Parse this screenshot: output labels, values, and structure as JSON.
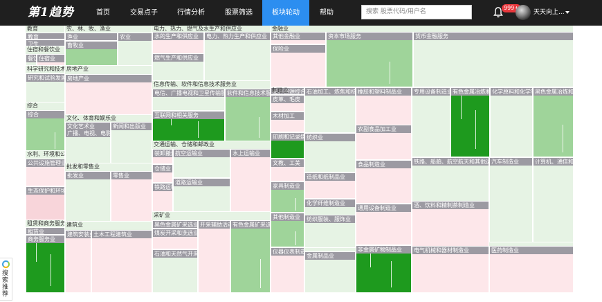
{
  "header": {
    "logo": "第1趋势",
    "nav": [
      {
        "label": "首页",
        "active": false
      },
      {
        "label": "交易点子",
        "active": false
      },
      {
        "label": "行情分析",
        "active": false
      },
      {
        "label": "股票筛选",
        "active": false
      },
      {
        "label": "板块轮动",
        "active": true
      },
      {
        "label": "帮助",
        "active": false
      }
    ],
    "search_placeholder": "搜索 股票代码/用户名",
    "notification_count": "999+",
    "username": "天天向上..."
  },
  "sidebar": {
    "label": "搜索推荐"
  },
  "colors": {
    "dark_green": "#1e9a1e",
    "mid_green": "#9fd49a",
    "light_green": "#e6f3e4",
    "light_pink": "#fde7ea",
    "pink": "#f8d5da",
    "label_gray": "#9c9aa2"
  },
  "treemap": {
    "groups": [
      {
        "name": "教育",
        "cells": [
          {
            "label": "教育",
            "color": "pink"
          },
          {
            "label": "卫生",
            "color": "pink"
          }
        ]
      },
      {
        "name": "住宿和餐饮业",
        "cells": [
          {
            "label": "餐饮业",
            "color": "light_green"
          },
          {
            "label": "住宿业",
            "color": "light_pink"
          }
        ]
      },
      {
        "name": "科学研究和技术服务业",
        "cells": [
          {
            "label": "研究和试验发展",
            "color": "light_green"
          }
        ]
      },
      {
        "name": "综合",
        "cells": [
          {
            "label": "综合",
            "color": "mid_green"
          }
        ]
      },
      {
        "name": "水利、环境和公共设施管理业",
        "cells": [
          {
            "label": "公共设施管理业",
            "color": "light_pink"
          },
          {
            "label": "生态保护和环境治理业",
            "color": "pink"
          }
        ]
      },
      {
        "name": "租赁和商务服务业",
        "cells": [
          {
            "label": "租赁业",
            "color": "light_pink"
          },
          {
            "label": "商务服务业",
            "color": "dark_green"
          }
        ]
      },
      {
        "name": "农、林、牧、渔业",
        "cells": [
          {
            "label": "渔业",
            "color": "light_green"
          },
          {
            "label": "农业",
            "color": "light_green"
          },
          {
            "label": "畜牧业",
            "color": "mid_green"
          }
        ]
      },
      {
        "name": "房地产业",
        "cells": [
          {
            "label": "房地产业",
            "color": "light_pink"
          }
        ]
      },
      {
        "name": "文化、体育和娱乐业",
        "cells": [
          {
            "label": "文化艺术业",
            "color": "light_green"
          },
          {
            "label": "新闻和出版业",
            "color": "light_green"
          },
          {
            "label": "广播、电视、电影",
            "color": "light_green"
          }
        ]
      },
      {
        "name": "批发和零售业",
        "cells": [
          {
            "label": "批发业",
            "color": "light_green"
          },
          {
            "label": "零售业",
            "color": "light_pink"
          }
        ]
      },
      {
        "name": "建筑业",
        "cells": [
          {
            "label": "建筑安装业",
            "color": "light_pink"
          },
          {
            "label": "土木工程建筑业",
            "color": "light_pink"
          }
        ]
      },
      {
        "name": "电力、热力、燃气及水生产和供应业",
        "cells": [
          {
            "label": "水的生产和供应业",
            "color": "light_pink"
          },
          {
            "label": "电力、热力生产和供应业",
            "color": "light_green"
          },
          {
            "label": "燃气生产和供应业",
            "color": "light_green"
          }
        ]
      },
      {
        "name": "信息传输、软件和信息技术服务业",
        "cells": [
          {
            "label": "电信、广播电视和卫星传输服务",
            "color": "light_green"
          },
          {
            "label": "软件和信息技术服务业",
            "color": "mid_green"
          },
          {
            "label": "互联网和相关服务",
            "color": "dark_green"
          }
        ]
      },
      {
        "name": "交通运输、仓储和邮政业",
        "cells": [
          {
            "label": "装卸搬运",
            "color": "light_pink"
          },
          {
            "label": "航空运输业",
            "color": "light_green"
          },
          {
            "label": "水上运输业",
            "color": "light_pink"
          },
          {
            "label": "仓储业",
            "color": "light_pink"
          },
          {
            "label": "铁路运输业",
            "color": "light_pink"
          },
          {
            "label": "道路运输业",
            "color": "light_green"
          }
        ]
      },
      {
        "name": "采矿业",
        "cells": [
          {
            "label": "黑色金属矿采选业",
            "color": "light_green"
          },
          {
            "label": "开采辅助活动",
            "color": "light_pink"
          },
          {
            "label": "有色金属矿采选业",
            "color": "mid_green"
          },
          {
            "label": "煤炭开采和洗选业",
            "color": "light_pink"
          },
          {
            "label": "石油和天然气开采业",
            "color": "light_green"
          }
        ]
      },
      {
        "name": "金融业",
        "cells": [
          {
            "label": "其他金融业",
            "color": "light_pink"
          },
          {
            "label": "资本市场服务",
            "color": "mid_green"
          },
          {
            "label": "货币金融服务",
            "color": "light_green"
          },
          {
            "label": "保险业",
            "color": "light_pink"
          }
        ]
      },
      {
        "name": "制造业",
        "cells": [
          {
            "label": "废弃资源综合利用业",
            "color": "pink"
          },
          {
            "label": "皮革、毛皮",
            "color": "light_pink"
          },
          {
            "label": "石油加工、炼焦和核燃料加工业",
            "color": "light_green"
          },
          {
            "label": "橡胶和塑料制品业",
            "color": "light_pink"
          },
          {
            "label": "专用设备制造业",
            "color": "light_green"
          },
          {
            "label": "有色金属冶炼和压延加工业",
            "color": "dark_green"
          },
          {
            "label": "化学原料和化学制品制造业",
            "color": "light_green"
          },
          {
            "label": "黑色金属冶炼和压延加工业",
            "color": "mid_green"
          },
          {
            "label": "木材加工",
            "color": "light_pink"
          },
          {
            "label": "纺织业",
            "color": "light_green"
          },
          {
            "label": "印刷和记录媒介复制业",
            "color": "dark_green"
          },
          {
            "label": "农副食品加工业",
            "color": "light_pink"
          },
          {
            "label": "造纸和纸制品业",
            "color": "light_pink"
          },
          {
            "label": "文教、工美",
            "color": "light_pink"
          },
          {
            "label": "食品制造业",
            "color": "light_pink"
          },
          {
            "label": "铁路、船舶、航空航天和其他运输设备制造业",
            "color": "light_green"
          },
          {
            "label": "汽车制造业",
            "color": "light_green"
          },
          {
            "label": "计算机、通信和其他电子设备制造业",
            "color": "light_green"
          },
          {
            "label": "家具制造业",
            "color": "mid_green"
          },
          {
            "label": "化学纤维制造业",
            "color": "light_green"
          },
          {
            "label": "通用设备制造业",
            "color": "light_pink"
          },
          {
            "label": "酒、饮料和精制茶制造业",
            "color": "light_pink"
          },
          {
            "label": "其他制造业",
            "color": "mid_green"
          },
          {
            "label": "纺织服装、服饰业",
            "color": "light_green"
          },
          {
            "label": "仪器仪表制造业",
            "color": "light_pink"
          },
          {
            "label": "金属制品业",
            "color": "light_green"
          },
          {
            "label": "非金属矿物制品业",
            "color": "dark_green"
          },
          {
            "label": "电气机械和器材制造业",
            "color": "light_pink"
          },
          {
            "label": "医药制造业",
            "color": "light_pink"
          }
        ]
      }
    ]
  }
}
